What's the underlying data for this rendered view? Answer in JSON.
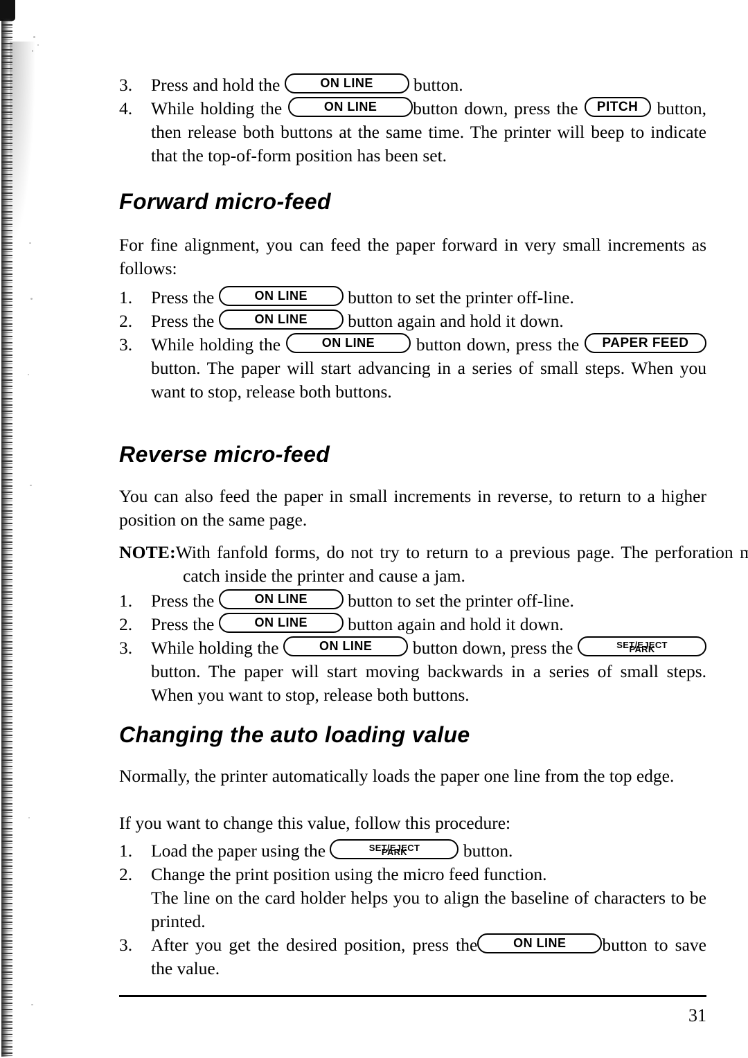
{
  "page": {
    "number": "31"
  },
  "keys": {
    "online": "ON LINE",
    "pitch": "PITCH",
    "paper_feed": "PAPER FEED",
    "set_eject": "SET/EJECT",
    "park": "PARK"
  },
  "top_list": {
    "items": [
      {
        "num": "3.",
        "before": "Press and hold the",
        "after": "button."
      },
      {
        "num": "4.",
        "before": "While holding the",
        "mid": "button down, press the",
        "after": "button, then release both buttons at the same time. The printer will beep to indicate that the top-of-form position has been set."
      }
    ]
  },
  "forward": {
    "heading": "Forward micro-feed",
    "intro": "For fine alignment, you can feed the paper forward in very small increments as follows:",
    "items": [
      {
        "num": "1.",
        "before": "Press the",
        "after": "button to set the printer off-line."
      },
      {
        "num": "2.",
        "before": "Press the",
        "after": "button again and hold it down."
      },
      {
        "num": "3.",
        "before": "While holding the",
        "mid": "button down, press the",
        "after": "button. The paper will start advancing in a series of small steps. When you want to stop, release both buttons."
      }
    ]
  },
  "reverse": {
    "heading": "Reverse micro-feed",
    "intro": "You can also feed the paper in small increments in reverse, to return to a higher position on the same page.",
    "note_label": "NOTE:",
    "note_text": "With fanfold forms, do not try to return to a previous page. The perforation may catch inside the printer and cause a jam.",
    "items": [
      {
        "num": "1.",
        "before": "Press the",
        "after": "button to set the printer off-line."
      },
      {
        "num": "2.",
        "before": "Press the",
        "after": "button again and hold it down."
      },
      {
        "num": "3.",
        "before": "While holding the",
        "mid": "button down, press the",
        "after": "button. The paper will start moving backwards in a series of small steps. When you want to stop, release both buttons."
      }
    ]
  },
  "autoload": {
    "heading": "Changing the auto loading value",
    "intro_1": "Normally, the printer automatically loads the paper one line from the top edge.",
    "intro_2": "If you want to change this value, follow this procedure:",
    "items": [
      {
        "num": "1.",
        "before": "Load the paper using the",
        "after": "button."
      },
      {
        "num": "2.",
        "before": "Change the print position using the micro feed function.",
        "after": "The line on the card holder helps you to align the baseline of characters to be printed."
      },
      {
        "num": "3.",
        "before": "After you get the desired position, press the",
        "after": "button to save the value."
      }
    ]
  }
}
